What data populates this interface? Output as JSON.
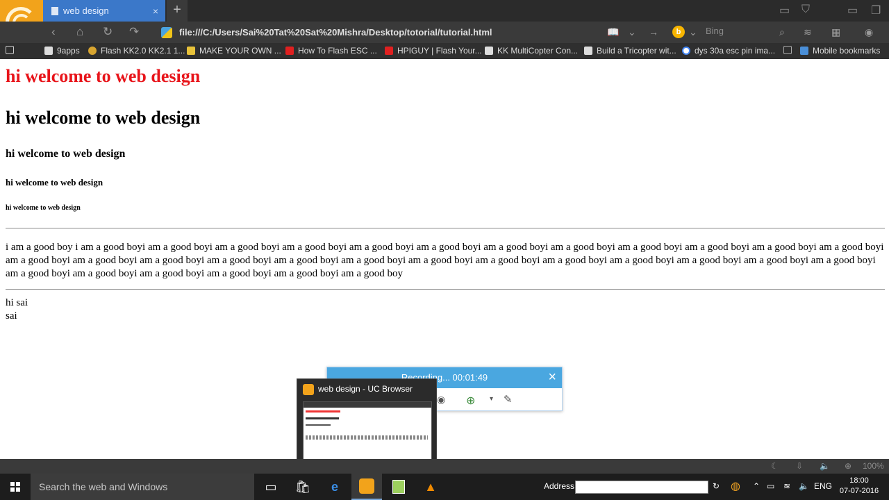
{
  "browser": {
    "tab_title": "web design",
    "tab_close": "×",
    "new_tab": "+",
    "url": "file:///C:/Users/Sai%20Tat%20Sat%20Mishra/Desktop/totorial/tutorial.html",
    "search_engine": "Bing",
    "bookmarks": [
      "9apps",
      "Flash KK2.0 KK2.1 1...",
      "MAKE YOUR OWN ...",
      "How To Flash ESC ...",
      "HPIGUY | Flash Your...",
      "KK MultiCopter Con...",
      "Build a Tricopter wit...",
      "dys 30a esc pin ima...",
      "Mobile bookmarks"
    ],
    "zoom": "100%"
  },
  "page": {
    "h1": "hi welcome to web design",
    "h2": "hi welcome to web design",
    "h3": "hi welcome to web design",
    "h4": "hi welcome to web design",
    "h5": "hi welcome to web design",
    "paragraph": "i am a good boy i am a good boyi am a good boyi am a good boyi am a good boyi am a good boyi am a good boyi am a good boyi am a good boyi am a good boyi am a good boyi am a good boyi am a good boyi am a good boyi am a good boyi am a good boyi am a good boyi am a good boyi am a good boyi am a good boyi am a good boyi am a good boyi am a good boyi am a good boyi am a good boyi am a good boyi am a good boyi am a good boyi am a good boyi am a good boyi am a good boyi am a good boy",
    "line1": "hi sai",
    "line2": "sai",
    "heading_color": "#e8141a"
  },
  "recorder": {
    "status": "Recording... 00:01:49",
    "close": "×"
  },
  "thumbnail": {
    "title": "web design - UC Browser"
  },
  "taskbar": {
    "search_placeholder": "Search the web and Windows",
    "address_label": "Address",
    "language": "ENG",
    "time": "18:00",
    "date": "07-07-2016"
  }
}
